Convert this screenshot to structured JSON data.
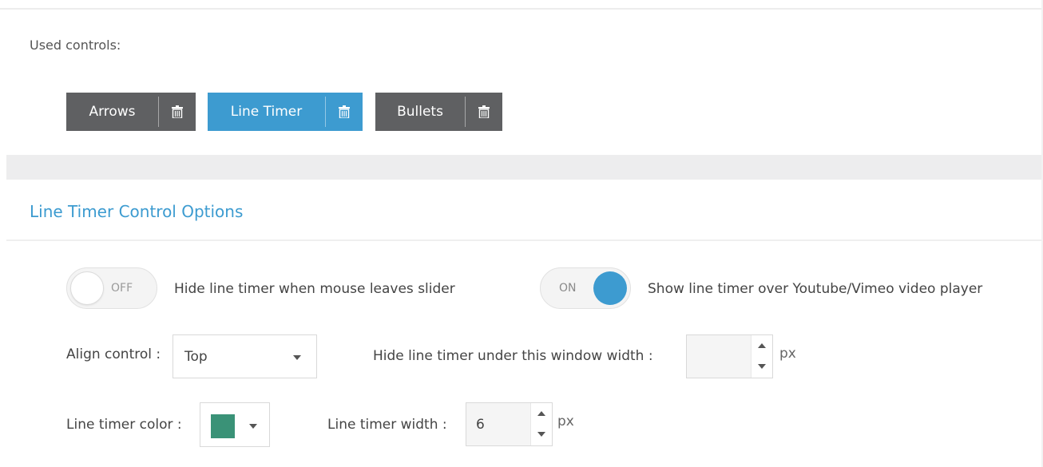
{
  "used_controls": {
    "label": "Used controls:",
    "buttons": [
      {
        "label": "Arrows",
        "active": false
      },
      {
        "label": "Line Timer",
        "active": true
      },
      {
        "label": "Bullets",
        "active": false
      }
    ]
  },
  "section": {
    "title": "Line Timer Control Options"
  },
  "options": {
    "hide_on_leave": {
      "state": "OFF",
      "label": "Hide line timer when mouse leaves slider"
    },
    "show_over_video": {
      "state": "ON",
      "label": "Show line timer over Youtube/Vimeo video player"
    },
    "align": {
      "label": "Align control :",
      "value": "Top"
    },
    "hide_width": {
      "label": "Hide line timer under this window width :",
      "value": "",
      "unit": "px"
    },
    "color": {
      "label": "Line timer color :",
      "value": "#3a9277"
    },
    "timer_width": {
      "label": "Line timer width :",
      "value": "6",
      "unit": "px"
    }
  },
  "colors": {
    "accent": "#3d9bd0",
    "button_dark": "#5f6062"
  },
  "icons": {
    "delete": "trash-icon",
    "dropdown": "caret-down-icon",
    "spin_up": "arrow-up-icon",
    "spin_down": "arrow-down-icon"
  }
}
